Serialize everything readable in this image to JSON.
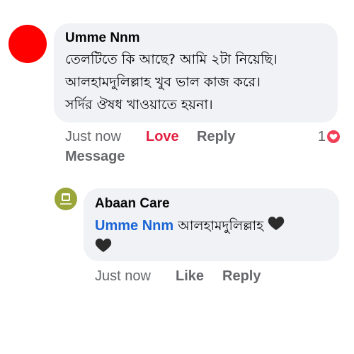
{
  "main_comment": {
    "author": "Umme Nnm",
    "lines": [
      "তেলটিতে কি আছে? আমি ২টা নিয়েছি।",
      "আলহামদুলিল্লাহ খুব ভাল কাজ করে।",
      "সর্দির ঔষধ খাওয়াতে হয়না।"
    ],
    "actions": {
      "time": "Just now",
      "reaction": "Love",
      "reply": "Reply",
      "message": "Message"
    },
    "reaction_count": "1",
    "reaction_icon": "heart-icon",
    "avatar_color": "#fe0000"
  },
  "reply_comment": {
    "author": "Abaan Care",
    "mention": "Umme Nnm",
    "text": "আলহামদুলিল্লাহ",
    "emoji": "black-heart",
    "actions": {
      "time": "Just now",
      "like": "Like",
      "reply": "Reply"
    },
    "avatar_color": "#9aa63a"
  },
  "colors": {
    "bubble": "#f0f2f5",
    "love": "#e41e3f",
    "mention": "#1b64d6",
    "meta": "#65676b"
  }
}
